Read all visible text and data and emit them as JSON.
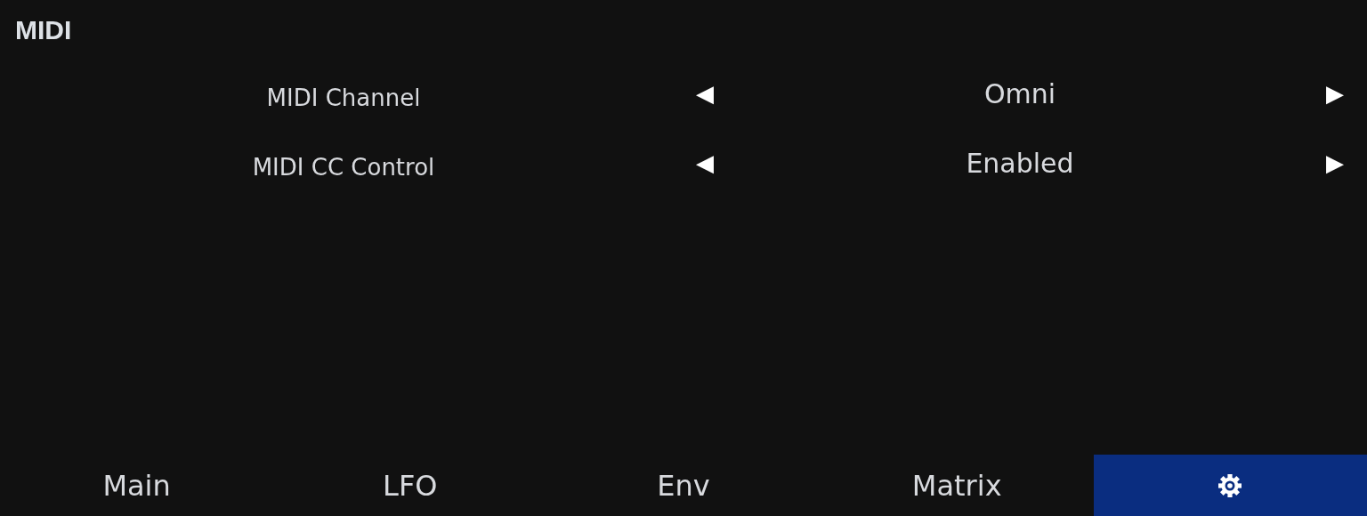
{
  "section": {
    "title": "MIDI"
  },
  "settings": [
    {
      "label": "MIDI Channel",
      "prev": "◀",
      "value": "Omni",
      "next": "▶"
    },
    {
      "label": "MIDI CC Control",
      "prev": "◀",
      "value": "Enabled",
      "next": "▶"
    }
  ],
  "tabs": [
    {
      "kind": "text",
      "label": "Main",
      "selected": false
    },
    {
      "kind": "text",
      "label": "LFO",
      "selected": false
    },
    {
      "kind": "text",
      "label": "Env",
      "selected": false
    },
    {
      "kind": "text",
      "label": "Matrix",
      "selected": false
    },
    {
      "kind": "gear",
      "selected": true
    }
  ]
}
